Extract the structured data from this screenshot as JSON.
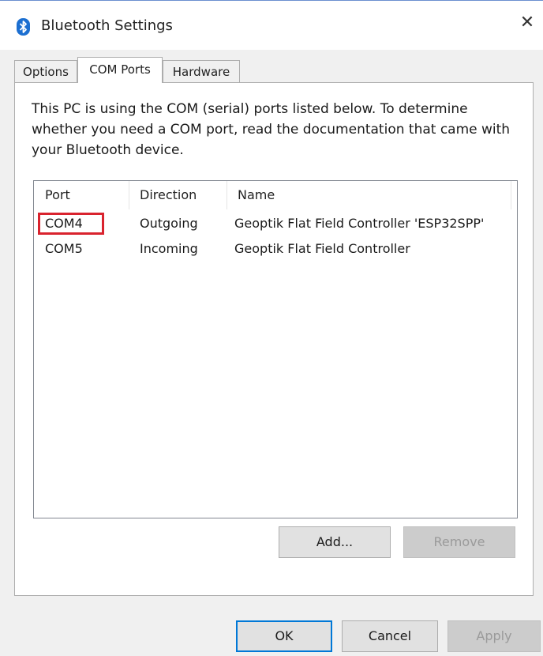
{
  "window": {
    "title": "Bluetooth Settings",
    "close_glyph": "✕",
    "icon": "bluetooth-icon",
    "accent_color": "#0078d7"
  },
  "tabs": [
    {
      "label": "Options"
    },
    {
      "label": "COM Ports",
      "active": true
    },
    {
      "label": "Hardware"
    }
  ],
  "panel": {
    "description": "This PC is using the COM (serial) ports listed below. To determine whether you need a COM port, read the documentation that came with your Bluetooth device.",
    "list": {
      "columns": [
        "Port",
        "Direction",
        "Name"
      ],
      "rows": [
        {
          "port": "COM4",
          "direction": "Outgoing",
          "name": "Geoptik Flat Field Controller 'ESP32SPP'",
          "highlighted": true
        },
        {
          "port": "COM5",
          "direction": "Incoming",
          "name": "Geoptik Flat Field Controller"
        }
      ],
      "highlight_color": "#d9232e"
    },
    "add_label": "Add...",
    "remove_label": "Remove"
  },
  "footer": {
    "ok_label": "OK",
    "cancel_label": "Cancel",
    "apply_label": "Apply"
  }
}
